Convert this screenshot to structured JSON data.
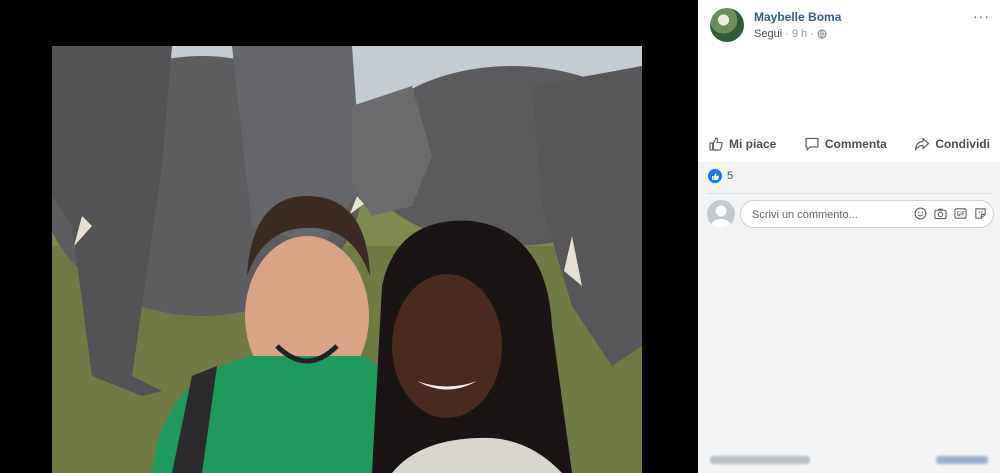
{
  "post": {
    "author": "Maybelle Boma",
    "follow_label": "Segui",
    "separator": "·",
    "time": "9 h",
    "more_label": "···"
  },
  "actions": {
    "like": "Mi piace",
    "comment": "Commenta",
    "share": "Condividi"
  },
  "reactions": {
    "count": "5"
  },
  "comment_box": {
    "placeholder": "Scrivi un commento..."
  },
  "colors": {
    "link": "#385898",
    "like_blue": "#1877f2",
    "panel_grey": "#f2f3f5"
  }
}
